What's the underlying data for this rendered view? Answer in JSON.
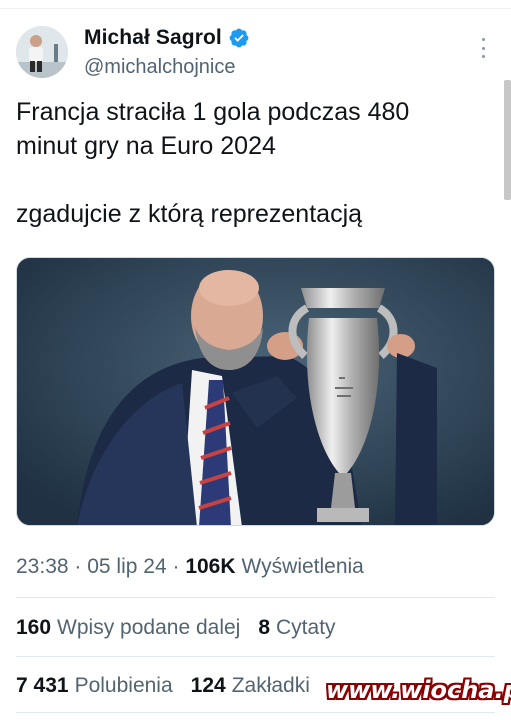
{
  "author": {
    "display_name": "Michał Sagrol",
    "handle": "@michalchojnice",
    "avatar_icon": "avatar-photo",
    "verified_icon": "verified-badge-icon",
    "verified_color": "#1d9bf0"
  },
  "tweet": {
    "line1": "Francja straciła 1 gola podczas 480\nminut gry na Euro 2024",
    "line2": "zgadujcie z którą reprezentacją"
  },
  "media": {
    "description_icon": "photo-coach-with-euro-trophy"
  },
  "meta": {
    "time": "23:38",
    "dot1": " · ",
    "date": "05 lip 24",
    "dot2": " · ",
    "views_count": "106K",
    "views_label": "Wyświetlenia"
  },
  "stats_row1": {
    "reposts_count": "160",
    "reposts_label": "Wpisy podane dalej",
    "quotes_count": "8",
    "quotes_label": "Cytaty"
  },
  "stats_row2": {
    "likes_count": "7 431",
    "likes_label": "Polubienia",
    "bookmarks_count": "124",
    "bookmarks_label": "Zakładki"
  },
  "watermark": "www.wiocha.pl"
}
